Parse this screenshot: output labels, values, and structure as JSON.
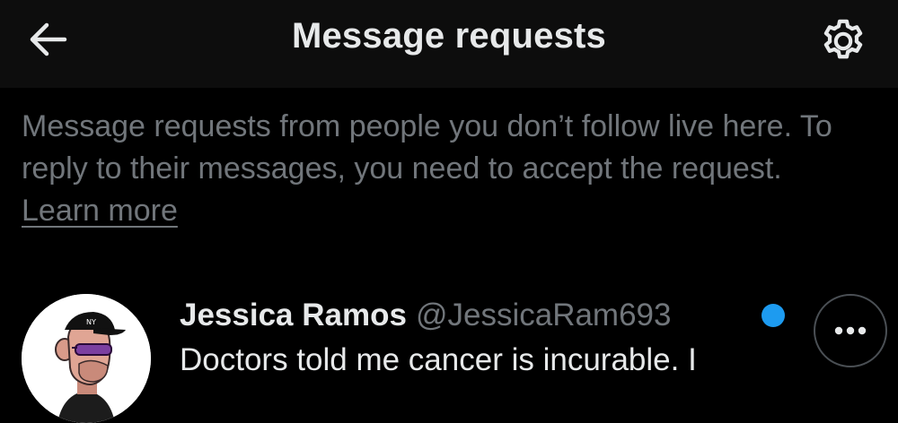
{
  "header": {
    "title": "Message requests",
    "back_icon": "arrow-left-icon",
    "settings_icon": "gear-icon"
  },
  "info": {
    "text": "Message requests from people you don’t follow live here. To reply to their messages, you need to accept the request.",
    "learn_more": "Learn more"
  },
  "requests": [
    {
      "name": "Jessica Ramos",
      "handle": "@JessicaRam693",
      "preview": "Doctors told me cancer is incurable. I",
      "unread": true,
      "more_icon": "more-horizontal-icon"
    }
  ],
  "colors": {
    "background": "#000000",
    "header_background": "#0d0d0d",
    "primary_text": "#e7e9ea",
    "secondary_text": "#71767b",
    "accent": "#1d9bf0"
  }
}
